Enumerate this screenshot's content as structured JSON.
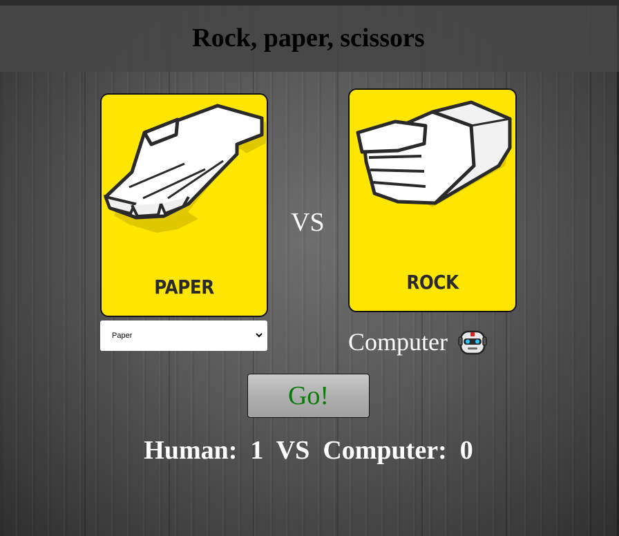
{
  "header": {
    "title": "Rock, paper, scissors"
  },
  "player": {
    "card_label": "PAPER",
    "choice_select": {
      "selected": "Paper",
      "options": [
        "Paper"
      ]
    }
  },
  "versus": {
    "label": "VS"
  },
  "computer": {
    "card_label": "ROCK",
    "label": "Computer",
    "icon": "robot-icon"
  },
  "actions": {
    "go_label": "Go!"
  },
  "score": {
    "human_label": "Human:",
    "human_value": "1",
    "vs_label": "VS",
    "computer_label": "Computer:",
    "computer_value": "0"
  },
  "colors": {
    "card_yellow": "#ffe600",
    "go_text": "#0a7a0a",
    "header_bg": "#464646"
  }
}
